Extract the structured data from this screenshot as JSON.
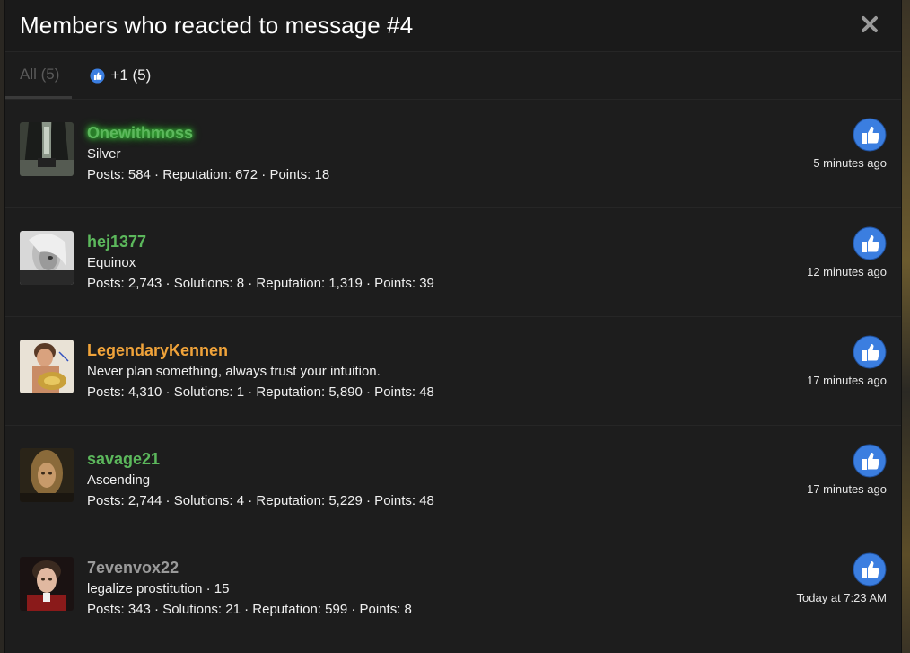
{
  "dialog": {
    "title": "Members who reacted to message #4"
  },
  "tabs": [
    {
      "label": "All (5)"
    },
    {
      "label": "+1 (5)"
    }
  ],
  "colors": {
    "like_blue": "#3b7ee0",
    "name_green": "#5cb85c",
    "name_orange": "#f0a33a",
    "name_gray": "#9a9a9a"
  },
  "members": [
    {
      "username": "Onewithmoss",
      "user_title": "Silver",
      "stats": "Posts: 584 · Reputation: 672 · Points: 18",
      "reaction_time": "5 minutes ago",
      "reaction_icon": "like-icon"
    },
    {
      "username": "hej1377",
      "user_title": "Equinox",
      "stats": "Posts: 2,743 · Solutions: 8 · Reputation: 1,319 · Points: 39",
      "reaction_time": "12 minutes ago",
      "reaction_icon": "like-icon"
    },
    {
      "username": "LegendaryKennen",
      "user_title": "Never plan something, always trust your intuition.",
      "stats": "Posts: 4,310 · Solutions: 1 · Reputation: 5,890 · Points: 48",
      "reaction_time": "17 minutes ago",
      "reaction_icon": "like-icon"
    },
    {
      "username": "savage21",
      "user_title": "Ascending",
      "stats": "Posts: 2,744 · Solutions: 4 · Reputation: 5,229 · Points: 48",
      "reaction_time": "17 minutes ago",
      "reaction_icon": "like-icon"
    },
    {
      "username": "7evenvox22",
      "user_title": "legalize prostitution · 15",
      "stats": "Posts: 343 · Solutions: 21 · Reputation: 599 · Points: 8",
      "reaction_time": "Today at 7:23 AM",
      "reaction_icon": "like-icon"
    }
  ]
}
